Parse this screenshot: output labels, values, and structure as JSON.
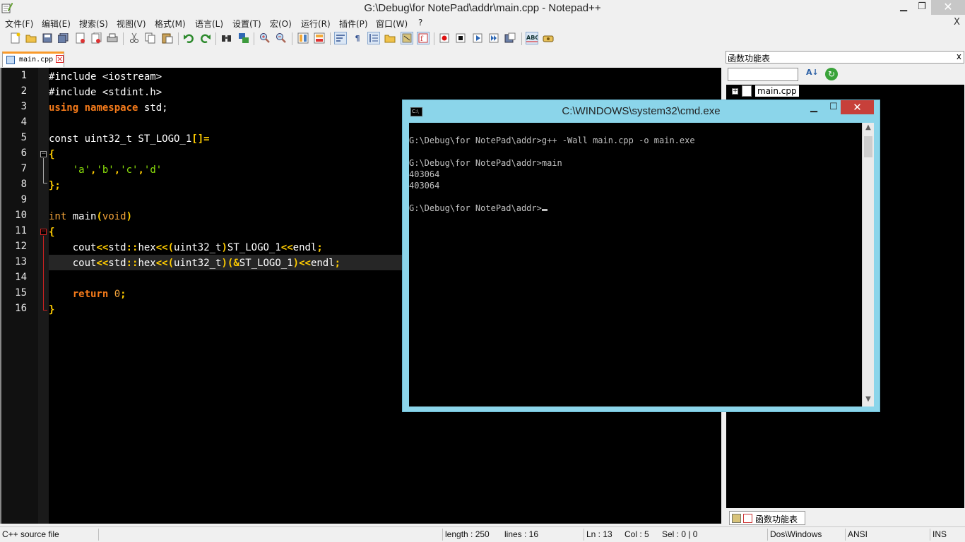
{
  "window": {
    "title": "G:\\Debug\\for NotePad\\addr\\main.cpp - Notepad++",
    "min": "▁",
    "max": "❐",
    "close": "✕"
  },
  "menu": {
    "items": [
      "文件(F)",
      "编辑(E)",
      "搜索(S)",
      "视图(V)",
      "格式(M)",
      "语言(L)",
      "设置(T)",
      "宏(O)",
      "运行(R)",
      "插件(P)",
      "窗口(W)",
      "?"
    ],
    "close": "X"
  },
  "tabs": [
    {
      "label": "main.cpp",
      "close": "×"
    }
  ],
  "editor": {
    "line_numbers": [
      "1",
      "2",
      "3",
      "4",
      "5",
      "6",
      "7",
      "8",
      "9",
      "10",
      "11",
      "12",
      "13",
      "14",
      "15",
      "16"
    ],
    "current_line": 13
  },
  "function_list": {
    "title": "函数功能表",
    "close": "x",
    "search_value": "",
    "tree_items": [
      {
        "label": "main.cpp",
        "expand": "+"
      }
    ],
    "bottom_tab_label": "函数功能表",
    "sort_label": "A↓",
    "refresh_label": "↻"
  },
  "statusbar": {
    "filetype": "C++ source file",
    "length": "length : 250",
    "lines": "lines : 16",
    "ln": "Ln : 13",
    "col": "Col : 5",
    "sel": "Sel : 0 | 0",
    "eol": "Dos\\Windows",
    "encoding": "ANSI",
    "mode": "INS"
  },
  "cmd": {
    "title": "C:\\WINDOWS\\system32\\cmd.exe",
    "icon_text": "C:\\",
    "min": "▁",
    "max": "☐",
    "close": "✕",
    "lines": [
      "G:\\Debug\\for NotePad\\addr>g++ -Wall main.cpp -o main.exe",
      "",
      "G:\\Debug\\for NotePad\\addr>main",
      "403064",
      "403064",
      "",
      "G:\\Debug\\for NotePad\\addr>"
    ],
    "scroll_up": "▲",
    "scroll_down": "▼"
  },
  "colors": {
    "keyword": "#f47a1a",
    "operator": "#ffcc00",
    "string": "#8ce10b",
    "editor_bg": "#000000",
    "cmd_frame": "#8bd5ea",
    "tab_accent": "#f99a2a"
  },
  "code": {
    "l1": {
      "a": "#include <iostream>"
    },
    "l2": {
      "a": "#include <stdint.h>"
    },
    "l3": {
      "kw1": "using",
      "kw2": "namespace",
      "rest": " std;"
    },
    "l5": {
      "a": "const uint32_t ST_LOGO_1",
      "op": "[]="
    },
    "l6": {
      "op": "{"
    },
    "l7": {
      "indent": "    ",
      "s1": "'a'",
      "c1": ",",
      "s2": "'b'",
      "c2": ",",
      "s3": "'c'",
      "c3": ",",
      "s4": "'d'"
    },
    "l8": {
      "op": "};"
    },
    "l10": {
      "type": "int",
      "sp": " main",
      "op1": "(",
      "t2": "void",
      "op2": ")"
    },
    "l11": {
      "op": "{"
    },
    "l12": {
      "indent": "    ",
      "a": "cout",
      "op1": "<<",
      "b": "std",
      "op2": "::",
      "c": "hex",
      "op3": "<<(",
      "d": "uint32_t",
      "op4": ")",
      "e": "ST_LOGO_1",
      "op5": "<<",
      "f": "endl",
      "op6": ";"
    },
    "l13": {
      "indent": "    ",
      "a": "cout",
      "op1": "<<",
      "b": "std",
      "op2": "::",
      "c": "hex",
      "op3": "<<(",
      "d": "uint32_t",
      "op4": ")(&",
      "e": "ST_LOGO_1",
      "op5": ")<<",
      "f": "endl",
      "op6": ";"
    },
    "l15": {
      "indent": "    ",
      "kw": "return",
      "sp": " ",
      "num": "0",
      "op": ";"
    },
    "l16": {
      "op": "}"
    }
  }
}
